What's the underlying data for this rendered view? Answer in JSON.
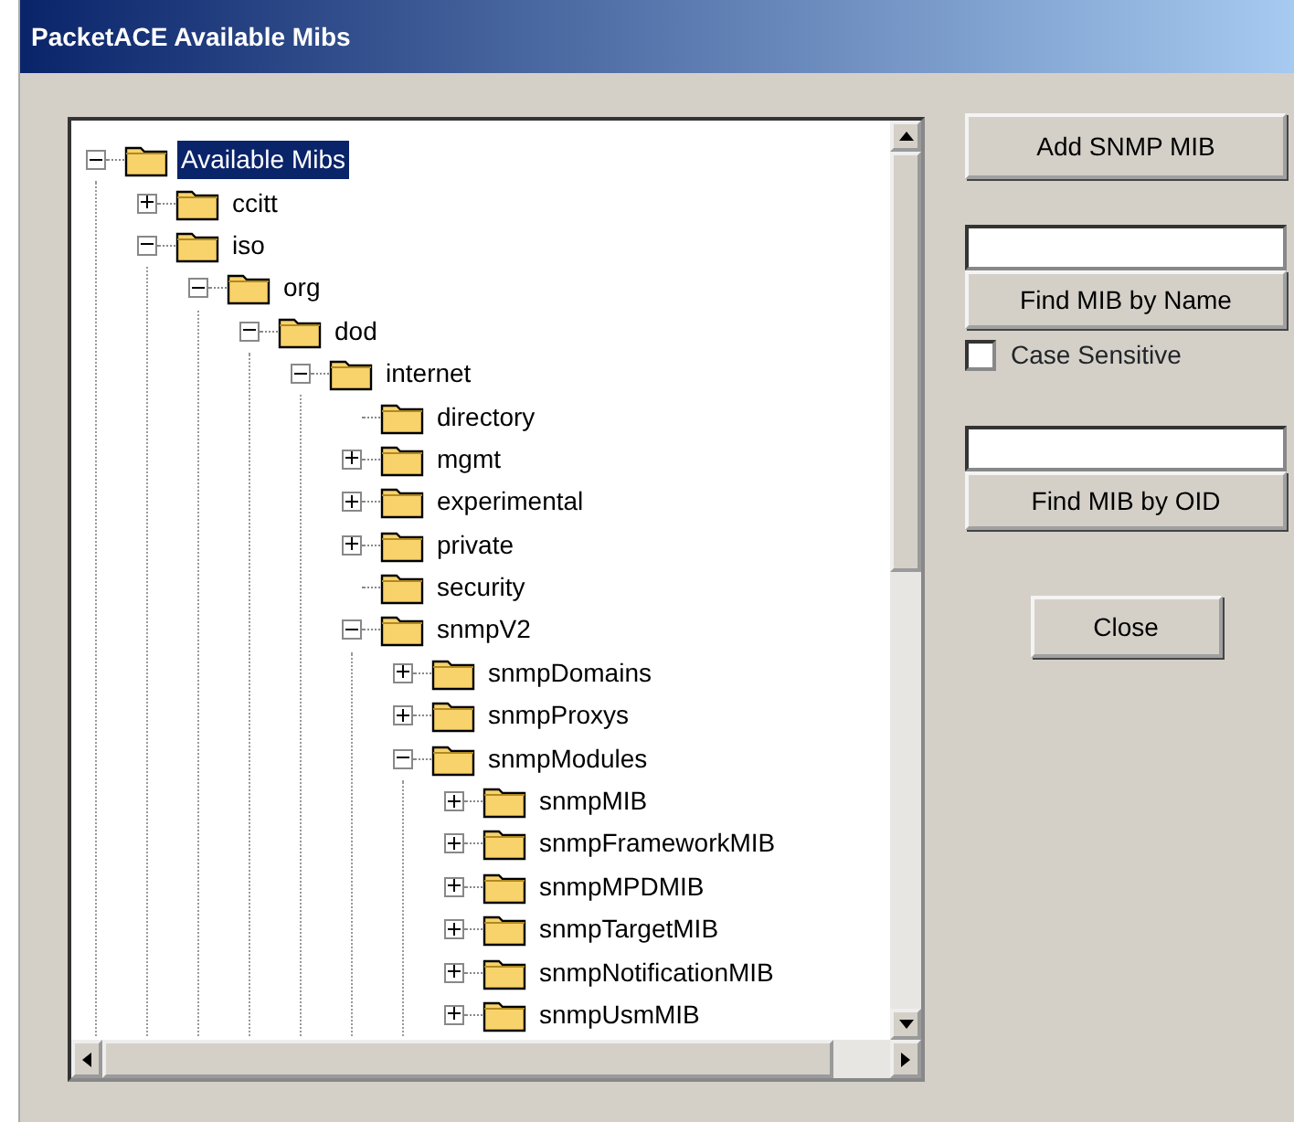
{
  "window": {
    "title": "PacketACE Available Mibs"
  },
  "tree": [
    {
      "label": "Available Mibs",
      "kind": "branch",
      "expanded": true,
      "selected": true,
      "children": [
        {
          "label": "ccitt",
          "kind": "branch",
          "expanded": false,
          "selected": false
        },
        {
          "label": "iso",
          "kind": "branch",
          "expanded": true,
          "selected": false,
          "children": [
            {
              "label": "org",
              "kind": "branch",
              "expanded": true,
              "selected": false,
              "children": [
                {
                  "label": "dod",
                  "kind": "branch",
                  "expanded": true,
                  "selected": false,
                  "children": [
                    {
                      "label": "internet",
                      "kind": "branch",
                      "expanded": true,
                      "selected": false,
                      "children": [
                        {
                          "label": "directory",
                          "kind": "leaf",
                          "selected": false
                        },
                        {
                          "label": "mgmt",
                          "kind": "branch",
                          "expanded": false,
                          "selected": false
                        },
                        {
                          "label": "experimental",
                          "kind": "branch",
                          "expanded": false,
                          "selected": false
                        },
                        {
                          "label": "private",
                          "kind": "branch",
                          "expanded": false,
                          "selected": false
                        },
                        {
                          "label": "security",
                          "kind": "leaf",
                          "selected": false
                        },
                        {
                          "label": "snmpV2",
                          "kind": "branch",
                          "expanded": true,
                          "selected": false,
                          "children": [
                            {
                              "label": "snmpDomains",
                              "kind": "branch",
                              "expanded": false,
                              "selected": false
                            },
                            {
                              "label": "snmpProxys",
                              "kind": "branch",
                              "expanded": false,
                              "selected": false
                            },
                            {
                              "label": "snmpModules",
                              "kind": "branch",
                              "expanded": true,
                              "selected": false,
                              "children": [
                                {
                                  "label": "snmpMIB",
                                  "kind": "branch",
                                  "expanded": false,
                                  "selected": false
                                },
                                {
                                  "label": "snmpFrameworkMIB",
                                  "kind": "branch",
                                  "expanded": false,
                                  "selected": false
                                },
                                {
                                  "label": "snmpMPDMIB",
                                  "kind": "branch",
                                  "expanded": false,
                                  "selected": false
                                },
                                {
                                  "label": "snmpTargetMIB",
                                  "kind": "branch",
                                  "expanded": false,
                                  "selected": false
                                },
                                {
                                  "label": "snmpNotificationMIB",
                                  "kind": "branch",
                                  "expanded": false,
                                  "selected": false
                                },
                                {
                                  "label": "snmpUsmMIB",
                                  "kind": "branch",
                                  "expanded": false,
                                  "selected": false
                                }
                              ]
                            }
                          ]
                        }
                      ]
                    }
                  ]
                }
              ]
            }
          ]
        }
      ]
    }
  ],
  "add_button": "Add SNMP MIB",
  "find_name": {
    "button": "Find MIB by Name"
  },
  "case_sensitive": {
    "label": "Case Sensitive",
    "checked": false
  },
  "find_oid": {
    "button": "Find MIB by OID"
  },
  "close_button": "Close"
}
